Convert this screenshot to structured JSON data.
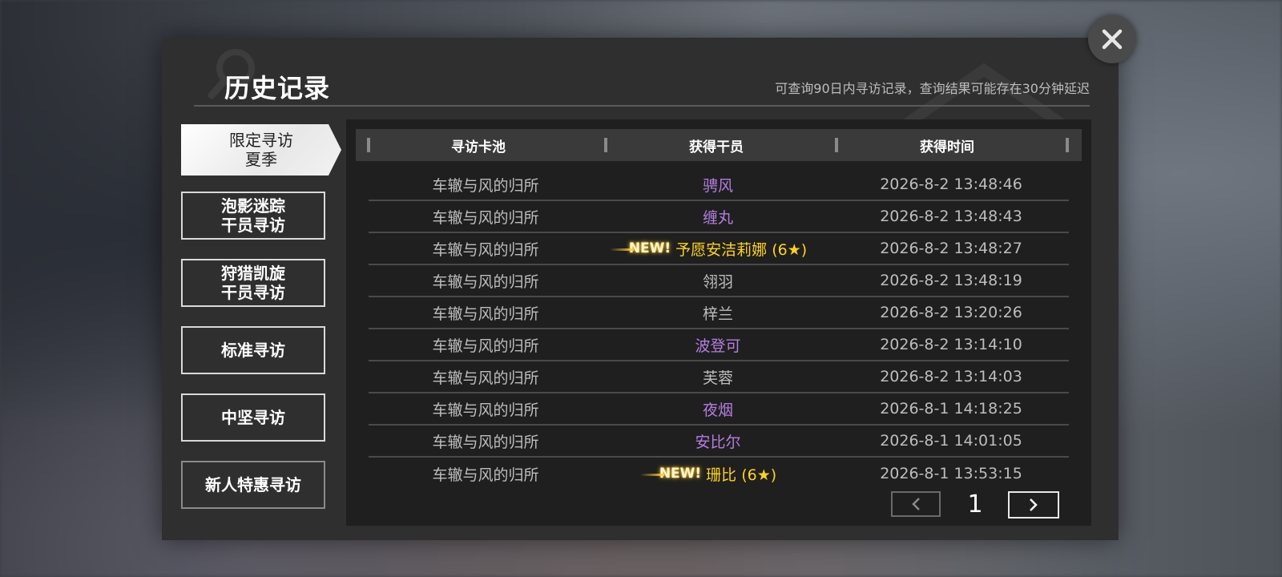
{
  "header": {
    "title": "历史记录",
    "subtitle": "可查询90日内寻访记录，查询结果可能存在30分钟延迟"
  },
  "sidebar": {
    "items": [
      {
        "line1": "限定寻访",
        "line2": "夏季",
        "active": true
      },
      {
        "line1": "泡影迷踪",
        "line2": "干员寻访",
        "active": false
      },
      {
        "line1": "狩猎凯旋",
        "line2": "干员寻访",
        "active": false
      },
      {
        "line1": "标准寻访",
        "line2": "",
        "active": false
      },
      {
        "line1": "中坚寻访",
        "line2": "",
        "active": false
      },
      {
        "line1": "新人特惠寻访",
        "line2": "",
        "active": false
      }
    ]
  },
  "table": {
    "headers": [
      "寻访卡池",
      "获得干员",
      "获得时间"
    ],
    "rows": [
      {
        "pool": "车辙与风的归所",
        "operator": "骋风",
        "new_tag": "",
        "time": "2026-8-2 13:48:46",
        "rarity_color": "purple"
      },
      {
        "pool": "车辙与风的归所",
        "operator": "缠丸",
        "new_tag": "",
        "time": "2026-8-2 13:48:43",
        "rarity_color": "purple"
      },
      {
        "pool": "车辙与风的归所",
        "operator": "予愿安洁莉娜 (6★)",
        "new_tag": "NEW!",
        "time": "2026-8-2 13:48:27",
        "rarity_color": "gold"
      },
      {
        "pool": "车辙与风的归所",
        "operator": "翎羽",
        "new_tag": "",
        "time": "2026-8-2 13:48:19",
        "rarity_color": "gray"
      },
      {
        "pool": "车辙与风的归所",
        "operator": "梓兰",
        "new_tag": "",
        "time": "2026-8-2 13:20:26",
        "rarity_color": "gray"
      },
      {
        "pool": "车辙与风的归所",
        "operator": "波登可",
        "new_tag": "",
        "time": "2026-8-2 13:14:10",
        "rarity_color": "purple"
      },
      {
        "pool": "车辙与风的归所",
        "operator": "芙蓉",
        "new_tag": "",
        "time": "2026-8-2 13:14:03",
        "rarity_color": "gray"
      },
      {
        "pool": "车辙与风的归所",
        "operator": "夜烟",
        "new_tag": "",
        "time": "2026-8-1 14:18:25",
        "rarity_color": "purple"
      },
      {
        "pool": "车辙与风的归所",
        "operator": "安比尔",
        "new_tag": "",
        "time": "2026-8-1 14:01:05",
        "rarity_color": "purple"
      },
      {
        "pool": "车辙与风的归所",
        "operator": "珊比 (6★)",
        "new_tag": "NEW!",
        "time": "2026-8-1 13:53:15",
        "rarity_color": "gold"
      }
    ]
  },
  "pager": {
    "current_page": "1",
    "prev_icon": "chevron-left-icon",
    "next_icon": "chevron-right-icon"
  },
  "colors": {
    "purple": "#b37ee0",
    "gold": "#ffd21f",
    "gray": "#bdbdbd"
  },
  "close_icon": "close-icon"
}
